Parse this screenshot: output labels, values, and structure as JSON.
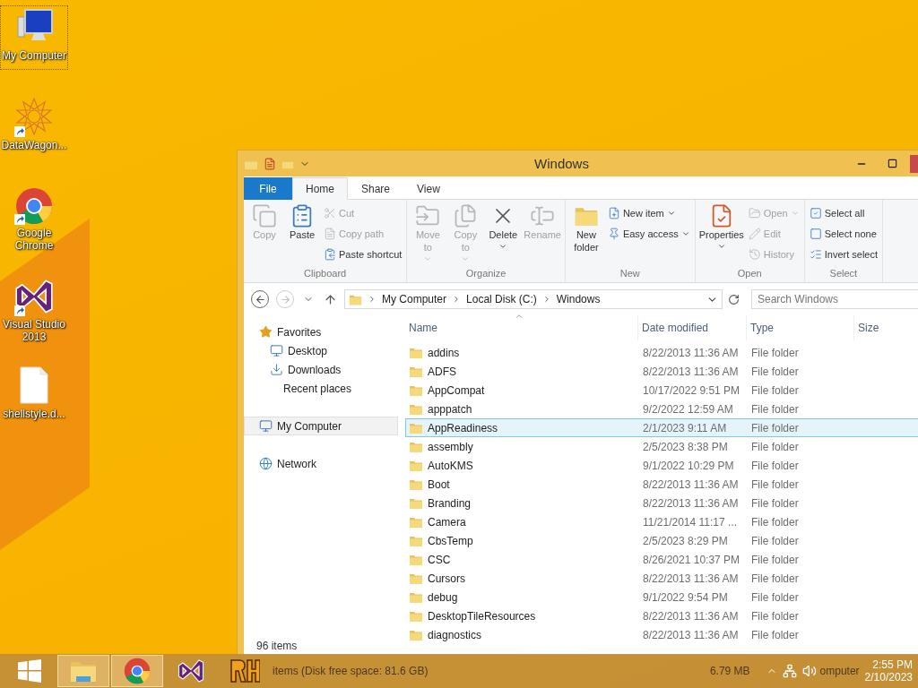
{
  "desktop_icons": [
    {
      "label": "My Computer",
      "kind": "computer",
      "shortcut": false,
      "selected": true
    },
    {
      "label": "DataWagon...",
      "kind": "mandala",
      "shortcut": true,
      "selected": false
    },
    {
      "label": "Google Chrome",
      "kind": "chrome",
      "shortcut": true,
      "selected": false
    },
    {
      "label": "Visual Studio 2013",
      "kind": "vs",
      "shortcut": true,
      "selected": false
    },
    {
      "label": "shellstyle.d...",
      "kind": "file",
      "shortcut": false,
      "selected": false
    }
  ],
  "window": {
    "title": "Windows",
    "tabs": [
      {
        "label": "File",
        "kind": "file",
        "selected": false
      },
      {
        "label": "Home",
        "kind": "tab",
        "selected": true
      },
      {
        "label": "Share",
        "kind": "tab",
        "selected": false
      },
      {
        "label": "View",
        "kind": "tab",
        "selected": false
      }
    ],
    "ribbon_groups": [
      {
        "label": "Clipboard",
        "large_buttons": [
          {
            "label_lines": [
              "Copy"
            ],
            "kind": "copy",
            "disabled": true,
            "dropdown": false
          },
          {
            "label_lines": [
              "Paste"
            ],
            "kind": "paste",
            "disabled": false,
            "dropdown": false
          }
        ],
        "small_buttons": [
          {
            "label": "Cut",
            "kind": "cut",
            "disabled": true,
            "dropdown": false
          },
          {
            "label": "Copy path",
            "kind": "copypath",
            "disabled": true,
            "dropdown": false
          },
          {
            "label": "Paste shortcut",
            "kind": "pasteshortcut",
            "disabled": false,
            "dropdown": false
          }
        ]
      },
      {
        "label": "Organize",
        "large_buttons": [
          {
            "label_lines": [
              "Move",
              "to"
            ],
            "kind": "move",
            "disabled": true,
            "dropdown": true
          },
          {
            "label_lines": [
              "Copy",
              "to"
            ],
            "kind": "copyto",
            "disabled": true,
            "dropdown": true
          },
          {
            "label_lines": [
              "Delete"
            ],
            "kind": "delete",
            "disabled": false,
            "dropdown": true
          },
          {
            "label_lines": [
              "Rename"
            ],
            "kind": "rename",
            "disabled": true,
            "dropdown": false
          }
        ]
      },
      {
        "label": "New",
        "large_buttons": [
          {
            "label_lines": [
              "New",
              "folder"
            ],
            "kind": "newfolder",
            "disabled": false,
            "dropdown": false
          }
        ],
        "small_buttons": [
          {
            "label": "New item",
            "kind": "newitem",
            "disabled": false,
            "dropdown": true
          },
          {
            "label": "Easy access",
            "kind": "easyaccess",
            "disabled": false,
            "dropdown": true
          }
        ]
      },
      {
        "label": "Open",
        "large_buttons": [
          {
            "label_lines": [
              "Properties"
            ],
            "kind": "properties",
            "disabled": false,
            "dropdown": true
          }
        ],
        "small_buttons": [
          {
            "label": "Open",
            "kind": "open",
            "disabled": true,
            "dropdown": true
          },
          {
            "label": "Edit",
            "kind": "edit",
            "disabled": true,
            "dropdown": false
          },
          {
            "label": "History",
            "kind": "history",
            "disabled": true,
            "dropdown": false
          }
        ]
      },
      {
        "label": "Select",
        "small_buttons": [
          {
            "label": "Select all",
            "kind": "selectall",
            "disabled": false,
            "dropdown": false
          },
          {
            "label": "Select none",
            "kind": "selectnone",
            "disabled": false,
            "dropdown": false
          },
          {
            "label": "Invert select",
            "kind": "invert",
            "disabled": false,
            "dropdown": false
          }
        ]
      }
    ],
    "nav_buttons": [
      {
        "kind": "back",
        "disabled": false
      },
      {
        "kind": "forward",
        "disabled": true
      },
      {
        "kind": "recent",
        "disabled": false
      },
      {
        "kind": "up",
        "disabled": false
      }
    ],
    "breadcrumbs": [
      "My Computer",
      "Local Disk (C:)",
      "Windows"
    ],
    "search": {
      "placeholder": "Search Windows"
    },
    "nav_pane": [
      {
        "label": "Favorites",
        "kind": "favorites",
        "selected": false,
        "children": [
          {
            "label": "Desktop",
            "kind": "desktop",
            "selected": false
          },
          {
            "label": "Downloads",
            "kind": "downloads",
            "selected": false
          },
          {
            "label": "Recent places",
            "kind": "recent",
            "selected": false
          }
        ]
      },
      {
        "label": "My Computer",
        "kind": "computer",
        "selected": true
      },
      {
        "label": "Network",
        "kind": "network",
        "selected": false
      }
    ],
    "columns": [
      {
        "label": "Name",
        "sorted": true
      },
      {
        "label": "Date modified",
        "sorted": false
      },
      {
        "label": "Type",
        "sorted": false
      },
      {
        "label": "Size",
        "sorted": false
      }
    ],
    "rows": [
      {
        "name": "addins",
        "date": "8/22/2013 11:36 AM",
        "type": "File folder",
        "selected": false
      },
      {
        "name": "ADFS",
        "date": "8/22/2013 11:36 AM",
        "type": "File folder",
        "selected": false
      },
      {
        "name": "AppCompat",
        "date": "10/17/2022 9:51 PM",
        "type": "File folder",
        "selected": false
      },
      {
        "name": "apppatch",
        "date": "9/2/2022 12:59 AM",
        "type": "File folder",
        "selected": false
      },
      {
        "name": "AppReadiness",
        "date": "2/1/2023 9:11 AM",
        "type": "File folder",
        "selected": true
      },
      {
        "name": "assembly",
        "date": "2/5/2023 8:38 PM",
        "type": "File folder",
        "selected": false
      },
      {
        "name": "AutoKMS",
        "date": "9/1/2022 10:29 PM",
        "type": "File folder",
        "selected": false
      },
      {
        "name": "Boot",
        "date": "8/22/2013 11:36 AM",
        "type": "File folder",
        "selected": false
      },
      {
        "name": "Branding",
        "date": "8/22/2013 11:36 AM",
        "type": "File folder",
        "selected": false
      },
      {
        "name": "Camera",
        "date": "11/21/2014 11:17 ...",
        "type": "File folder",
        "selected": false
      },
      {
        "name": "CbsTemp",
        "date": "2/5/2023 8:29 PM",
        "type": "File folder",
        "selected": false
      },
      {
        "name": "CSC",
        "date": "8/26/2021 10:37 PM",
        "type": "File folder",
        "selected": false
      },
      {
        "name": "Cursors",
        "date": "8/22/2013 11:36 AM",
        "type": "File folder",
        "selected": false
      },
      {
        "name": "debug",
        "date": "9/1/2022 9:54 PM",
        "type": "File folder",
        "selected": false
      },
      {
        "name": "DesktopTileResources",
        "date": "8/22/2013 11:36 AM",
        "type": "File folder",
        "selected": false
      },
      {
        "name": "diagnostics",
        "date": "8/22/2013 11:36 AM",
        "type": "File folder",
        "selected": false
      }
    ],
    "status": "96 items"
  },
  "taskbar": {
    "apps": [
      {
        "kind": "start",
        "open": false
      },
      {
        "kind": "explorer",
        "open": true
      },
      {
        "kind": "chrome",
        "open": true
      },
      {
        "kind": "vs",
        "open": false
      },
      {
        "kind": "rh",
        "open": false
      }
    ],
    "ghost_status": "items (Disk free space: 81.6 GB)",
    "ghost_size": "6.79 MB",
    "ghost_location": "omputer",
    "time": "2:55 PM",
    "date": "2/10/2023"
  }
}
